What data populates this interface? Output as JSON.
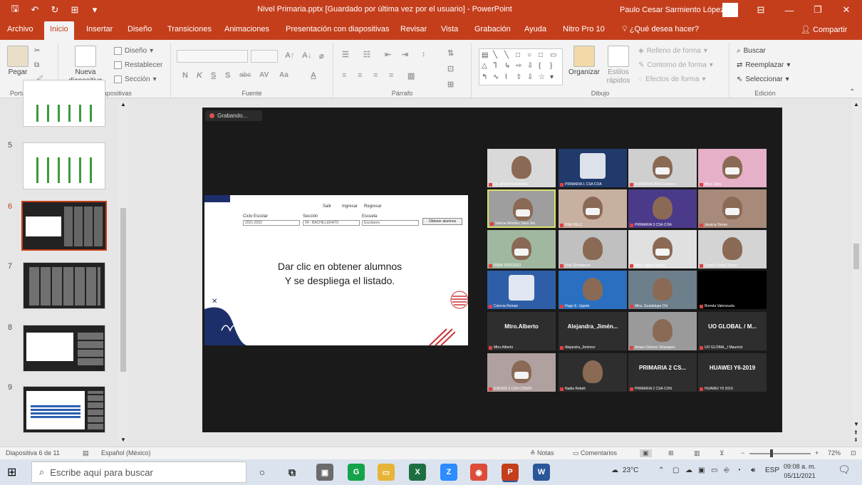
{
  "title_bar": {
    "document_title": "Nivel Primaria.pptx [Guardado por última vez por el usuario] - PowerPoint",
    "user": "Paulo Cesar Sarmiento López",
    "icons": [
      "save-icon",
      "undo-icon",
      "redo-icon",
      "start-from-beginning-icon",
      "customize-qat-icon"
    ],
    "window_controls": [
      "ribbon-display-options-icon",
      "minimize-icon",
      "restore-icon",
      "close-icon"
    ]
  },
  "tabs": [
    "Archivo",
    "Inicio",
    "Insertar",
    "Diseño",
    "Transiciones",
    "Animaciones",
    "Presentación con diapositivas",
    "Revisar",
    "Vista",
    "Grabación",
    "Ayuda",
    "Nitro Pro 10"
  ],
  "active_tab": "Inicio",
  "tell_me": "¿Qué desea hacer?",
  "share": "Compartir",
  "ribbon": {
    "groups": [
      "Portapapeles",
      "Diapositivas",
      "Fuente",
      "Párrafo",
      "Dibujo",
      "Edición"
    ],
    "clipboard": {
      "paste": "Pegar"
    },
    "slides": {
      "new_slide": "Nueva diapositiva",
      "layout": "Diseño",
      "reset": "Restablecer",
      "section": "Sección"
    },
    "font": {
      "bold": "N",
      "italic": "K",
      "underline": "S",
      "shadow": "S",
      "strike": "abc",
      "spacing": "AV",
      "case": "Aa",
      "color": "A"
    },
    "drawing": {
      "arrange": "Organizar",
      "quick_styles": "Estilos rápidos",
      "shape_fill": "Relleno de forma",
      "shape_outline": "Contorno de forma",
      "shape_effects": "Efectos de forma"
    },
    "editing": {
      "find": "Buscar",
      "replace": "Reemplazar",
      "select": "Seleccionar"
    }
  },
  "thumbnails": [
    {
      "number": "",
      "type": "bars"
    },
    {
      "number": "5",
      "type": "bars"
    },
    {
      "number": "6",
      "type": "dark",
      "selected": true
    },
    {
      "number": "7",
      "type": "dark"
    },
    {
      "number": "8",
      "type": "mixed"
    },
    {
      "number": "9",
      "type": "table"
    }
  ],
  "slide": {
    "recording": "Grabando...",
    "shared": {
      "tabs": [
        "Salir",
        "Ingresar",
        "Regresar"
      ],
      "fields": [
        {
          "label": "Ciclo Escolar",
          "value": "2021-2022"
        },
        {
          "label": "Sección",
          "value": "04 - BACHILLERATO"
        },
        {
          "label": "Escuela",
          "value": "Escolares"
        }
      ],
      "button": "Obtener alumnos",
      "text_line1": "Dar clic en obtener alumnos",
      "text_line2": "Y se despliega el listado."
    },
    "participants": [
      {
        "name": "Lic. Arturo Fernández",
        "kind": "video",
        "bg": "#d9d9d9"
      },
      {
        "name": "PRIMARIA 1 CSA COA",
        "kind": "logo",
        "bg": "#203a6b"
      },
      {
        "name": "SUPERVISORA Guerrero",
        "kind": "video",
        "bg": "#cfcfcf",
        "mask": true
      },
      {
        "name": "Miss Zaira",
        "kind": "video",
        "bg": "#e5b0c8",
        "mask": true
      },
      {
        "name": "Selene Méndez Sanz 3ro",
        "kind": "video",
        "bg": "#9e9e9e",
        "mask": true,
        "active": true
      },
      {
        "name": "PRE KELZ",
        "kind": "video",
        "bg": "#c8b0a0",
        "mask": true
      },
      {
        "name": "PRIMARIA 3 CSA COA",
        "kind": "video",
        "bg": "#4b3a8a"
      },
      {
        "name": "Jessica Torres",
        "kind": "video",
        "bg": "#a88a7a",
        "mask": true
      },
      {
        "name": "PRIM TERCERO",
        "kind": "video",
        "bg": "#a0b8a0",
        "mask": true
      },
      {
        "name": "Prof. Emmanuel",
        "kind": "video",
        "bg": "#c0c0c0"
      },
      {
        "name": "Mtra. Yatzin Duarte",
        "kind": "video",
        "bg": "#e0e0e0",
        "mask": true
      },
      {
        "name": "Coach Carlos Torres",
        "kind": "video",
        "bg": "#d4d4d4"
      },
      {
        "name": "Ciencia Roman",
        "kind": "logo",
        "bg": "#2f5ea8"
      },
      {
        "name": "Hugo E. Ugarte",
        "kind": "video",
        "bg": "#2a6fc0"
      },
      {
        "name": "Mtra. Guadalupe Chi",
        "kind": "video",
        "bg": "#6e7f8c"
      },
      {
        "name": "Brenda Valenzuela",
        "kind": "black",
        "bg": "#000000"
      },
      {
        "name": "Mtro.Alberto",
        "kind": "label",
        "label": "Mtro.Alberto",
        "bg": "#2e2e2e"
      },
      {
        "name": "Alejandra_Jiménez",
        "kind": "label",
        "label": "Alejandra_Jimén...",
        "bg": "#2e2e2e"
      },
      {
        "name": "Amaro Gómez Velazquez",
        "kind": "video",
        "bg": "#9a9a9a"
      },
      {
        "name": "UO GLOBAL_I Mauricio",
        "kind": "label",
        "label": "UO GLOBAL / M...",
        "bg": "#2e2e2e"
      },
      {
        "name": "KINDER 3 CSA CONZA",
        "kind": "video",
        "bg": "#b0a0a0",
        "mask": true
      },
      {
        "name": "Nadia Rebeli",
        "kind": "photo",
        "bg": "#2e2e2e"
      },
      {
        "name": "PRIMARIA 2 CSA CON",
        "kind": "label",
        "label": "PRIMARIA 2 CS...",
        "bg": "#2e2e2e"
      },
      {
        "name": "HUAWEI Y6 2019",
        "kind": "label",
        "label": "HUAWEI Y6-2019",
        "bg": "#2e2e2e"
      }
    ]
  },
  "status_bar": {
    "slide_info": "Diapositiva 6 de 11",
    "language": "Español (México)",
    "notes": "Notas",
    "comments": "Comentarios",
    "zoom": "72%"
  },
  "taskbar": {
    "search_placeholder": "Escribe aquí para buscar",
    "apps": [
      {
        "name": "store",
        "color": "#6b6b6b",
        "glyph": "▣"
      },
      {
        "name": "chrome-ext",
        "color": "#15a34a",
        "glyph": "G"
      },
      {
        "name": "file-explorer",
        "color": "#e8b339",
        "glyph": "▭"
      },
      {
        "name": "excel",
        "color": "#1d6f42",
        "glyph": "X"
      },
      {
        "name": "zoom",
        "color": "#2d8cff",
        "glyph": "Z"
      },
      {
        "name": "chrome",
        "color": "#dd4b39",
        "glyph": "◉"
      },
      {
        "name": "powerpoint",
        "color": "#c43e1c",
        "glyph": "P"
      },
      {
        "name": "word",
        "color": "#2b579a",
        "glyph": "W"
      }
    ],
    "weather": "23°C",
    "lang": "ESP",
    "time": "09:08 a. m.",
    "date": "05/11/2021"
  }
}
